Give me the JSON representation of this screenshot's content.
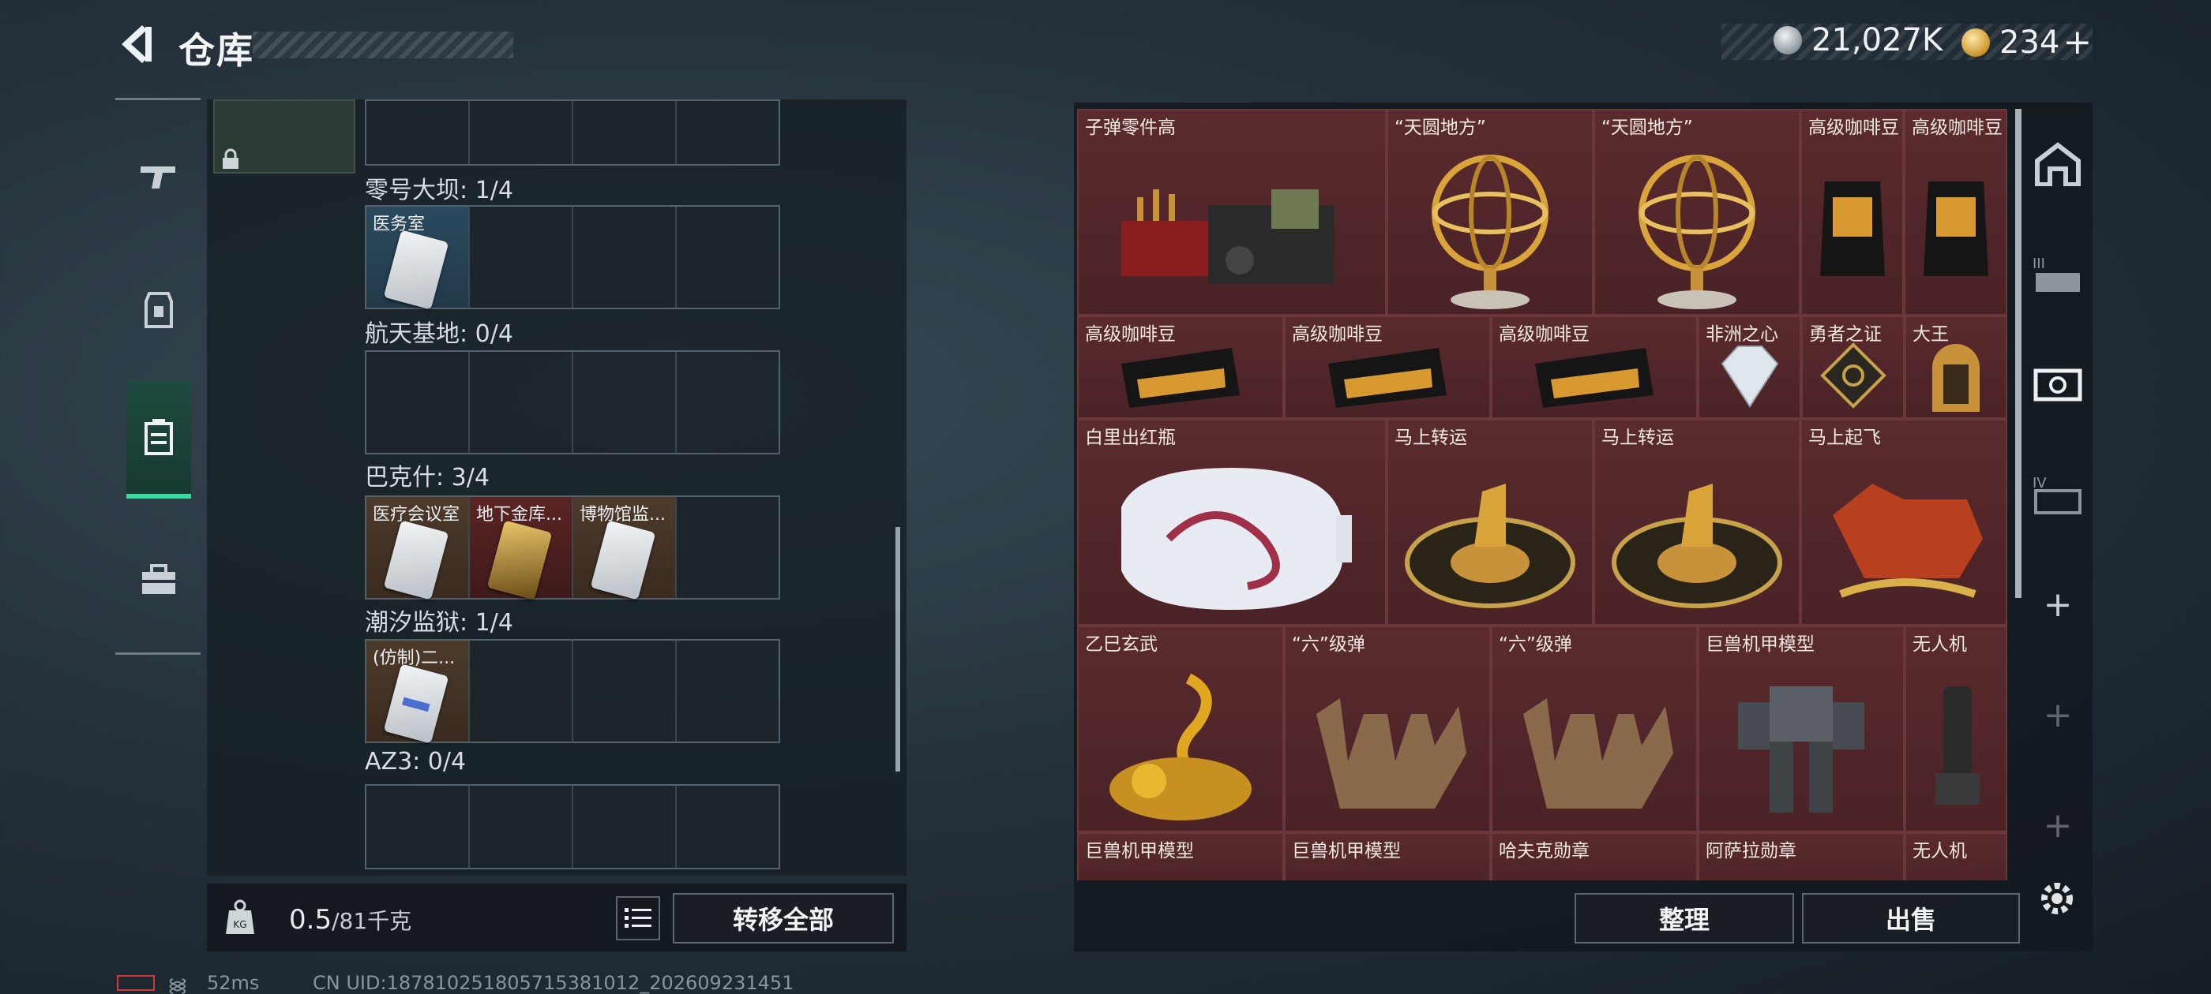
{
  "header": {
    "title": "仓库",
    "currency_silver": "21,027K",
    "currency_gold": "234",
    "currency_gold_plus": "+"
  },
  "storage": {
    "maps": [
      {
        "label": "零号大坝: 1/4",
        "slots": [
          {
            "name": "医务室",
            "color": "blue",
            "card": "silver"
          }
        ]
      },
      {
        "label": "航天基地: 0/4",
        "slots": []
      },
      {
        "label": "巴克什: 3/4",
        "slots": [
          {
            "name": "医疗会议室",
            "color": "brown",
            "card": "silver"
          },
          {
            "name": "地下金库...",
            "color": "red",
            "card": "gold"
          },
          {
            "name": "博物馆监...",
            "color": "brown",
            "card": "silver"
          }
        ]
      },
      {
        "label": "潮汐监狱: 1/4",
        "slots": [
          {
            "name": "(仿制)二...",
            "color": "brown",
            "card": "stripe"
          }
        ]
      },
      {
        "label": "AZ3: 0/4",
        "slots": []
      }
    ],
    "weight_current": "0.5",
    "weight_max": "/81千克",
    "transfer_all": "转移全部"
  },
  "items": [
    {
      "name": "子弹零件高",
      "icon": "ammo-crate"
    },
    {
      "name": "“天圆地方”",
      "icon": "armillary-sphere"
    },
    {
      "name": "“天圆地方”",
      "icon": "armillary-sphere"
    },
    {
      "name": "高级咖啡豆",
      "icon": "coffee-bag"
    },
    {
      "name": "高级咖啡豆",
      "icon": "coffee-bag"
    },
    {
      "name": "高级咖啡豆",
      "icon": "coffee-box"
    },
    {
      "name": "高级咖啡豆",
      "icon": "coffee-box"
    },
    {
      "name": "高级咖啡豆",
      "icon": "coffee-box"
    },
    {
      "name": "非洲之心",
      "icon": "diamond"
    },
    {
      "name": "勇者之证",
      "icon": "badge"
    },
    {
      "name": "大王",
      "icon": "idol"
    },
    {
      "name": "白里出红瓶",
      "icon": "vase"
    },
    {
      "name": "马上转运",
      "icon": "horse-wheel"
    },
    {
      "name": "马上转运",
      "icon": "horse-wheel"
    },
    {
      "name": "马上起飞",
      "icon": "red-horse"
    },
    {
      "name": "乙巳玄武",
      "icon": "golden-serpent"
    },
    {
      "name": "“六”级弹",
      "icon": "bronze-hand"
    },
    {
      "name": "“六”级弹",
      "icon": "bronze-hand"
    },
    {
      "name": "巨兽机甲模型",
      "icon": "mech"
    },
    {
      "name": "无人机",
      "icon": "drone-part"
    },
    {
      "name": "巨兽机甲模型",
      "icon": "mech"
    },
    {
      "name": "巨兽机甲模型",
      "icon": "mech"
    },
    {
      "name": "哈夫克勋章",
      "icon": "medal"
    },
    {
      "name": "阿萨拉勋章",
      "icon": "medal"
    },
    {
      "name": "无人机",
      "icon": "drone-part"
    }
  ],
  "right_tabs": [
    "home-icon",
    "III-icon",
    "II-icon",
    "IV-icon",
    "+",
    "+",
    "+"
  ],
  "buttons": {
    "sort": "整理",
    "sell": "出售"
  },
  "status_bar": {
    "ping": "52ms",
    "uid": "CN UID:187810251805715381012_202609231451"
  }
}
